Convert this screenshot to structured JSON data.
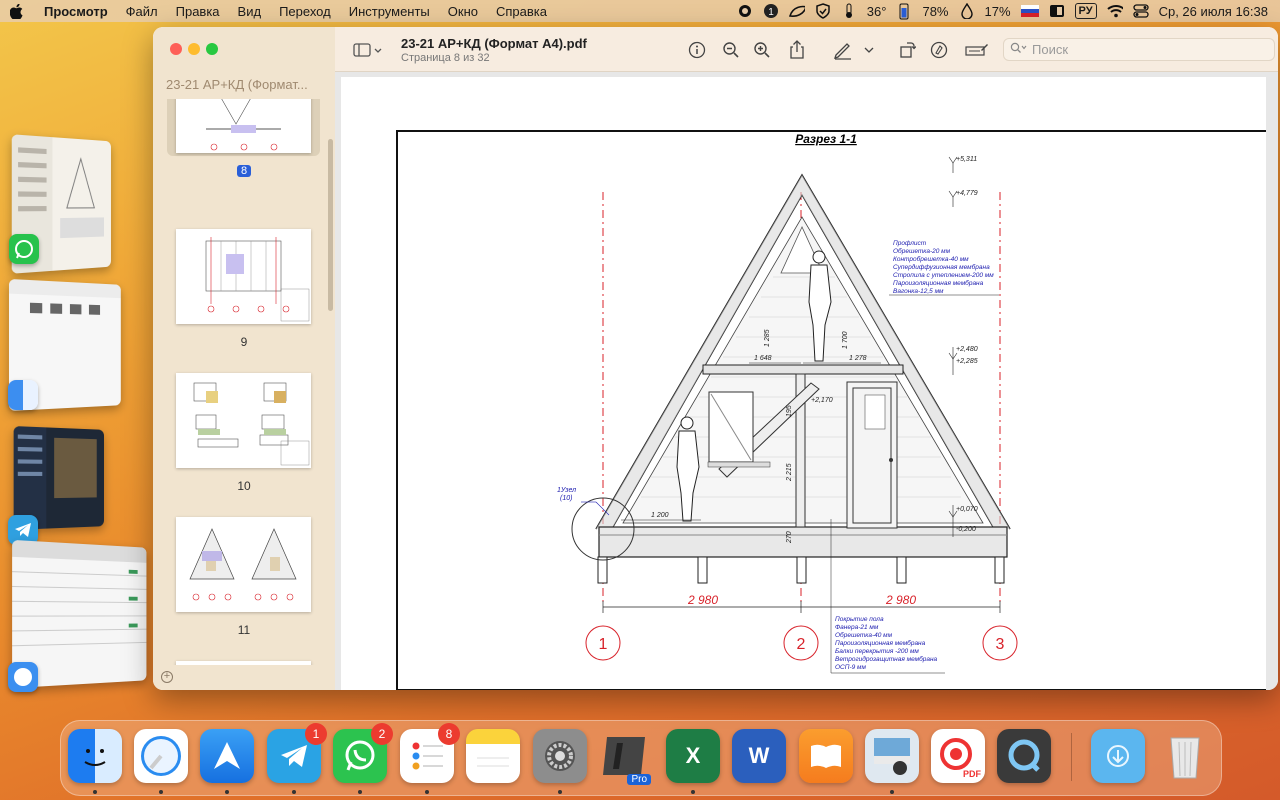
{
  "menubar": {
    "app_name": "Просмотр",
    "items": [
      "Файл",
      "Правка",
      "Вид",
      "Переход",
      "Инструменты",
      "Окно",
      "Справка"
    ],
    "status": {
      "temperature": "36°",
      "battery": "78%",
      "humidity": "17%",
      "input_source": "РУ",
      "datetime": "Ср, 26 июля  16:38"
    }
  },
  "window": {
    "sidebar_title": "23-21 АР+КД (Формат...",
    "doc_title": "23-21 АР+КД (Формат А4).pdf",
    "doc_subtitle": "Страница 8 из 32",
    "search_placeholder": "Поиск",
    "thumbnails": [
      {
        "page": "8",
        "selected": true
      },
      {
        "page": "9",
        "selected": false
      },
      {
        "page": "10",
        "selected": false
      },
      {
        "page": "11",
        "selected": false
      }
    ]
  },
  "drawing": {
    "title": "Разрез 1-1",
    "levels": [
      "+5,311",
      "+4,779",
      "+2,480",
      "+2,285",
      "+2,170",
      "+0,070",
      "-0,200"
    ],
    "dimensions": [
      "1 285",
      "1 700",
      "1 648",
      "1 278",
      "195",
      "2 215",
      "1 200",
      "270",
      "2 980",
      "2 980"
    ],
    "axes": [
      "1",
      "2",
      "3"
    ],
    "node_label": "1Узел",
    "node_sub": "(10)",
    "roof_layers": [
      "Профлист",
      "Обрешетка-20 мм",
      "Контробрешетка-40 мм",
      "Супердиффузионная мембрана",
      "Стропила с утеплением-200 мм",
      "Пароизоляционная мембрана",
      "Вагонка-12,5 мм"
    ],
    "floor_layers": [
      "Покрытие пола",
      "Фанера-21 мм",
      "Обрешетка-40 мм",
      "Пароизоляционная мембрана",
      "Балки перекрытия -200 мм",
      "Ветрогидрозащитная мембрана",
      "ОСП-9 мм"
    ]
  },
  "dock": {
    "badges": {
      "telegram": "1",
      "whatsapp": "2",
      "reminders": "8"
    },
    "parallels_label": "Pro",
    "excel_letter": "X",
    "word_letter": "W",
    "pdf_label": "PDF"
  },
  "colors": {
    "red_axis": "#d8222a",
    "annotation_blue": "#2020b0",
    "selection_blue": "#2a5fd8"
  }
}
